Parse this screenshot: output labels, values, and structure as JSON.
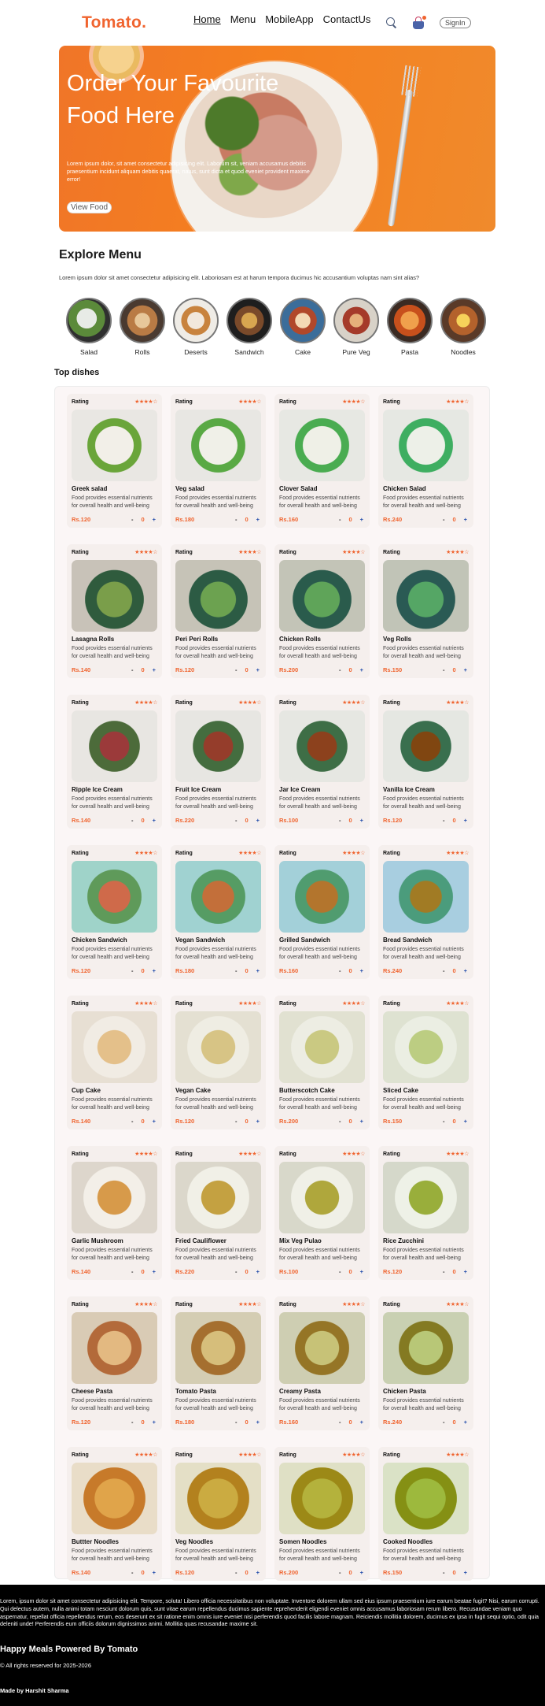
{
  "navbar": {
    "logo": "Tomato.",
    "links": [
      "Home",
      "Menu",
      "MobileApp",
      "ContactUs"
    ],
    "active": "Home",
    "signin_label": "SignIn",
    "accent_color": "#f0642f"
  },
  "hero": {
    "title": "Order Your Favourite Food Here",
    "description": "Lorem ipsum dolor, sit amet consectetur adipisicing elit. Laborum sit, veniam accusamus debitis praesentium incidunt aliquam debitis quaerat, natus, sunt dicta et quod eveniet provident maxime error!",
    "button_label": "View Food"
  },
  "explore": {
    "title": "Explore Menu",
    "description": "Lorem ipsum dolor sit amet consectetur adipisicing elit. Laboriosam est at harum tempora ducimus hic accusantium voluptas nam sint alias?",
    "items": [
      "Salad",
      "Rolls",
      "Deserts",
      "Sandwich",
      "Cake",
      "Pure Veg",
      "Pasta",
      "Noodles"
    ]
  },
  "top_dishes": {
    "title": "Top dishes",
    "rating_label": "Rating",
    "stars": "★★★★☆",
    "description": "Food provides essential nutrients for overall health and well-being",
    "minus": "-",
    "qty": "0",
    "plus": "+",
    "items": [
      {
        "name": "Greek salad",
        "price": "Rs.120"
      },
      {
        "name": "Veg salad",
        "price": "Rs.180"
      },
      {
        "name": "Clover Salad",
        "price": "Rs.160"
      },
      {
        "name": "Chicken Salad",
        "price": "Rs.240"
      },
      {
        "name": "Lasagna Rolls",
        "price": "Rs.140"
      },
      {
        "name": "Peri Peri Rolls",
        "price": "Rs.120"
      },
      {
        "name": "Chicken Rolls",
        "price": "Rs.200"
      },
      {
        "name": "Veg Rolls",
        "price": "Rs.150"
      },
      {
        "name": "Ripple Ice Cream",
        "price": "Rs.140"
      },
      {
        "name": "Fruit Ice Cream",
        "price": "Rs.220"
      },
      {
        "name": "Jar Ice Cream",
        "price": "Rs.100"
      },
      {
        "name": "Vanilla Ice Cream",
        "price": "Rs.120"
      },
      {
        "name": "Chicken Sandwich",
        "price": "Rs.120"
      },
      {
        "name": "Vegan Sandwich",
        "price": "Rs.180"
      },
      {
        "name": "Grilled Sandwich",
        "price": "Rs.160"
      },
      {
        "name": "Bread Sandwich",
        "price": "Rs.240"
      },
      {
        "name": "Cup Cake",
        "price": "Rs.140"
      },
      {
        "name": "Vegan Cake",
        "price": "Rs.120"
      },
      {
        "name": "Butterscotch Cake",
        "price": "Rs.200"
      },
      {
        "name": "Sliced Cake",
        "price": "Rs.150"
      },
      {
        "name": "Garlic Mushroom",
        "price": "Rs.140"
      },
      {
        "name": "Fried Cauliflower",
        "price": "Rs.220"
      },
      {
        "name": "Mix Veg Pulao",
        "price": "Rs.100"
      },
      {
        "name": "Rice Zucchini",
        "price": "Rs.120"
      },
      {
        "name": "Cheese Pasta",
        "price": "Rs.120"
      },
      {
        "name": "Tomato Pasta",
        "price": "Rs.180"
      },
      {
        "name": "Creamy Pasta",
        "price": "Rs.160"
      },
      {
        "name": "Chicken Pasta",
        "price": "Rs.240"
      },
      {
        "name": "Buttter Noodles",
        "price": "Rs.140"
      },
      {
        "name": "Veg Noodles",
        "price": "Rs.120"
      },
      {
        "name": "Somen Noodles",
        "price": "Rs.200"
      },
      {
        "name": "Cooked Noodles",
        "price": "Rs.150"
      }
    ]
  },
  "footer": {
    "text": "Lorem, ipsum dolor sit amet consectetur adipisicing elit. Tempore, soluta! Libero officia necessitatibus non voluptate. Inventore dolorem ullam sed eius ipsum praesentium iure earum beatae fugit? Nisi, earum corrupti. Qui delectus autem, nulla animi totam nesciunt dolorum quis, sunt vitae earum repellendus ducimus sapiente reprehenderit eligendi eveniet omnis accusamus laboriosam rerum libero. Recusandae veniam quo aspernatur, repellat officia repellendus rerum, eos deserunt ex sit ratione enim omnis iure eveniet nisi perferendis quod facilis labore magnam. Reiciendis mollitia dolorem, ducimus ex ipsa in fugit sequi optio, odit quia deleniti unde! Perferendis eum officiis dolorum dignissimos animi. Mollitia quas recusandae maxime sit.",
    "title": "Happy Meals Powered By Tomato",
    "rights": "© All rights reserved for 2025-2026",
    "made_by": "Made by Harshit Sharma"
  }
}
